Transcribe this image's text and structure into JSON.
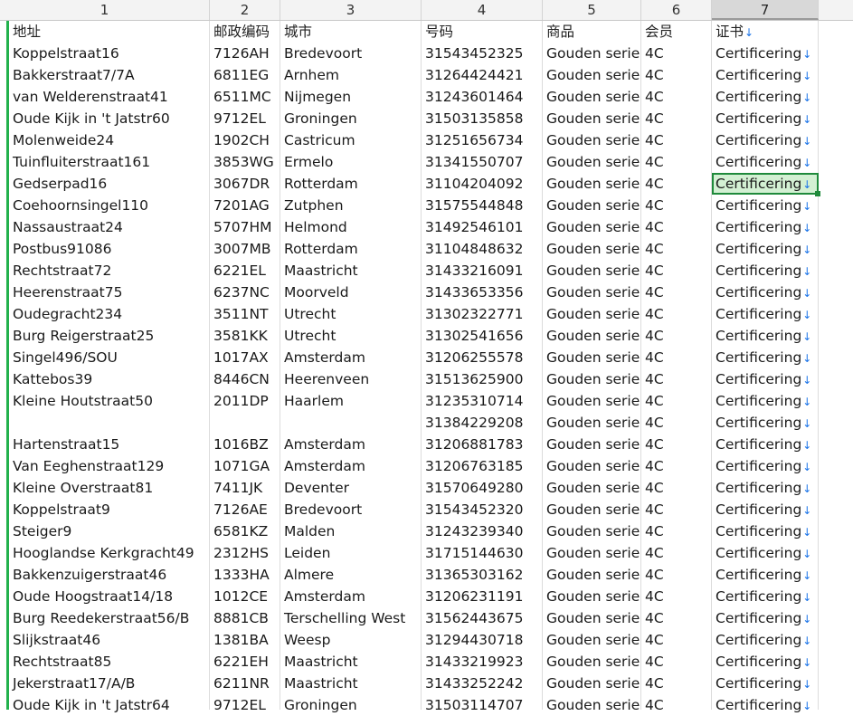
{
  "columns": [
    "1",
    "2",
    "3",
    "4",
    "5",
    "6",
    "7"
  ],
  "headers": {
    "address": "地址",
    "postcode": "邮政编码",
    "city": "城市",
    "number": "号码",
    "product": "商品",
    "member": "会员",
    "certificate": "证书"
  },
  "header_arrow": "↓",
  "cell_arrow": "↓",
  "rows": [
    {
      "address": "Koppelstraat16",
      "postcode": "7126AH",
      "city": "Bredevoort",
      "number": "31543452325",
      "product": "Gouden serie",
      "member": "4C",
      "certificate": "Certificering"
    },
    {
      "address": "Bakkerstraat7/7A",
      "postcode": "6811EG",
      "city": "Arnhem",
      "number": "31264424421",
      "product": "Gouden serie",
      "member": "4C",
      "certificate": "Certificering"
    },
    {
      "address": "van Welderenstraat41",
      "postcode": "6511MC",
      "city": "Nijmegen",
      "number": "31243601464",
      "product": "Gouden serie",
      "member": "4C",
      "certificate": "Certificering"
    },
    {
      "address": "Oude Kijk in 't Jatstr60",
      "postcode": "9712EL",
      "city": "Groningen",
      "number": "31503135858",
      "product": "Gouden serie",
      "member": "4C",
      "certificate": "Certificering"
    },
    {
      "address": "Molenweide24",
      "postcode": "1902CH",
      "city": "Castricum",
      "number": "31251656734",
      "product": "Gouden serie",
      "member": "4C",
      "certificate": "Certificering"
    },
    {
      "address": "Tuinfluiterstraat161",
      "postcode": "3853WG",
      "city": "Ermelo",
      "number": "31341550707",
      "product": "Gouden serie",
      "member": "4C",
      "certificate": "Certificering"
    },
    {
      "address": "Gedserpad16",
      "postcode": "3067DR",
      "city": "Rotterdam",
      "number": "31104204092",
      "product": "Gouden serie",
      "member": "4C",
      "certificate": "Certificering",
      "selected": true
    },
    {
      "address": "Coehoornsingel110",
      "postcode": "7201AG",
      "city": "Zutphen",
      "number": "31575544848",
      "product": "Gouden serie",
      "member": "4C",
      "certificate": "Certificering"
    },
    {
      "address": "Nassaustraat24",
      "postcode": "5707HM",
      "city": "Helmond",
      "number": "31492546101",
      "product": "Gouden serie",
      "member": "4C",
      "certificate": "Certificering"
    },
    {
      "address": "Postbus91086",
      "postcode": "3007MB",
      "city": "Rotterdam",
      "number": "31104848632",
      "product": "Gouden serie",
      "member": "4C",
      "certificate": "Certificering"
    },
    {
      "address": "Rechtstraat72",
      "postcode": "6221EL",
      "city": "Maastricht",
      "number": "31433216091",
      "product": "Gouden serie",
      "member": "4C",
      "certificate": "Certificering"
    },
    {
      "address": "Heerenstraat75",
      "postcode": "6237NC",
      "city": "Moorveld",
      "number": "31433653356",
      "product": "Gouden serie",
      "member": "4C",
      "certificate": "Certificering"
    },
    {
      "address": "Oudegracht234",
      "postcode": "3511NT",
      "city": "Utrecht",
      "number": "31302322771",
      "product": "Gouden serie",
      "member": "4C",
      "certificate": "Certificering"
    },
    {
      "address": "Burg Reigerstraat25",
      "postcode": "3581KK",
      "city": "Utrecht",
      "number": "31302541656",
      "product": "Gouden serie",
      "member": "4C",
      "certificate": "Certificering"
    },
    {
      "address": "Singel496/SOU",
      "postcode": "1017AX",
      "city": "Amsterdam",
      "number": "31206255578",
      "product": "Gouden serie",
      "member": "4C",
      "certificate": "Certificering"
    },
    {
      "address": "Kattebos39",
      "postcode": "8446CN",
      "city": "Heerenveen",
      "number": "31513625900",
      "product": "Gouden serie",
      "member": "4C",
      "certificate": "Certificering"
    },
    {
      "address": "Kleine Houtstraat50",
      "postcode": "2011DP",
      "city": "Haarlem",
      "number": "31235310714",
      "product": "Gouden serie",
      "member": "4C",
      "certificate": "Certificering"
    },
    {
      "address": "",
      "postcode": "",
      "city": "",
      "number": "31384229208",
      "product": "Gouden serie",
      "member": "4C",
      "certificate": "Certificering"
    },
    {
      "address": "Hartenstraat15",
      "postcode": "1016BZ",
      "city": "Amsterdam",
      "number": "31206881783",
      "product": "Gouden serie",
      "member": "4C",
      "certificate": "Certificering"
    },
    {
      "address": "Van Eeghenstraat129",
      "postcode": "1071GA",
      "city": "Amsterdam",
      "number": "31206763185",
      "product": "Gouden serie",
      "member": "4C",
      "certificate": "Certificering"
    },
    {
      "address": "Kleine Overstraat81",
      "postcode": "7411JK",
      "city": "Deventer",
      "number": "31570649280",
      "product": "Gouden serie",
      "member": "4C",
      "certificate": "Certificering"
    },
    {
      "address": "Koppelstraat9",
      "postcode": "7126AE",
      "city": "Bredevoort",
      "number": "31543452320",
      "product": "Gouden serie",
      "member": "4C",
      "certificate": "Certificering"
    },
    {
      "address": "Steiger9",
      "postcode": "6581KZ",
      "city": "Malden",
      "number": "31243239340",
      "product": "Gouden serie",
      "member": "4C",
      "certificate": "Certificering"
    },
    {
      "address": "Hooglandse Kerkgracht49",
      "postcode": "2312HS",
      "city": "Leiden",
      "number": "31715144630",
      "product": "Gouden serie",
      "member": "4C",
      "certificate": "Certificering"
    },
    {
      "address": "Bakkenzuigerstraat46",
      "postcode": "1333HA",
      "city": "Almere",
      "number": "31365303162",
      "product": "Gouden serie",
      "member": "4C",
      "certificate": "Certificering"
    },
    {
      "address": "Oude Hoogstraat14/18",
      "postcode": "1012CE",
      "city": "Amsterdam",
      "number": "31206231191",
      "product": "Gouden serie",
      "member": "4C",
      "certificate": "Certificering"
    },
    {
      "address": "Burg Reedekerstraat56/B",
      "postcode": "8881CB",
      "city": "Terschelling West",
      "number": "31562443675",
      "product": "Gouden serie",
      "member": "4C",
      "certificate": "Certificering"
    },
    {
      "address": "Slijkstraat46",
      "postcode": "1381BA",
      "city": "Weesp",
      "number": "31294430718",
      "product": "Gouden serie",
      "member": "4C",
      "certificate": "Certificering"
    },
    {
      "address": "Rechtstraat85",
      "postcode": "6221EH",
      "city": "Maastricht",
      "number": "31433219923",
      "product": "Gouden serie",
      "member": "4C",
      "certificate": "Certificering"
    },
    {
      "address": "Jekerstraat17/A/B",
      "postcode": "6211NR",
      "city": "Maastricht",
      "number": "31433252242",
      "product": "Gouden serie",
      "member": "4C",
      "certificate": "Certificering"
    },
    {
      "address": "Oude Kijk in 't Jatstr64",
      "postcode": "9712EL",
      "city": "Groningen",
      "number": "31503114707",
      "product": "Gouden serie",
      "member": "4C",
      "certificate": "Certificering"
    }
  ]
}
